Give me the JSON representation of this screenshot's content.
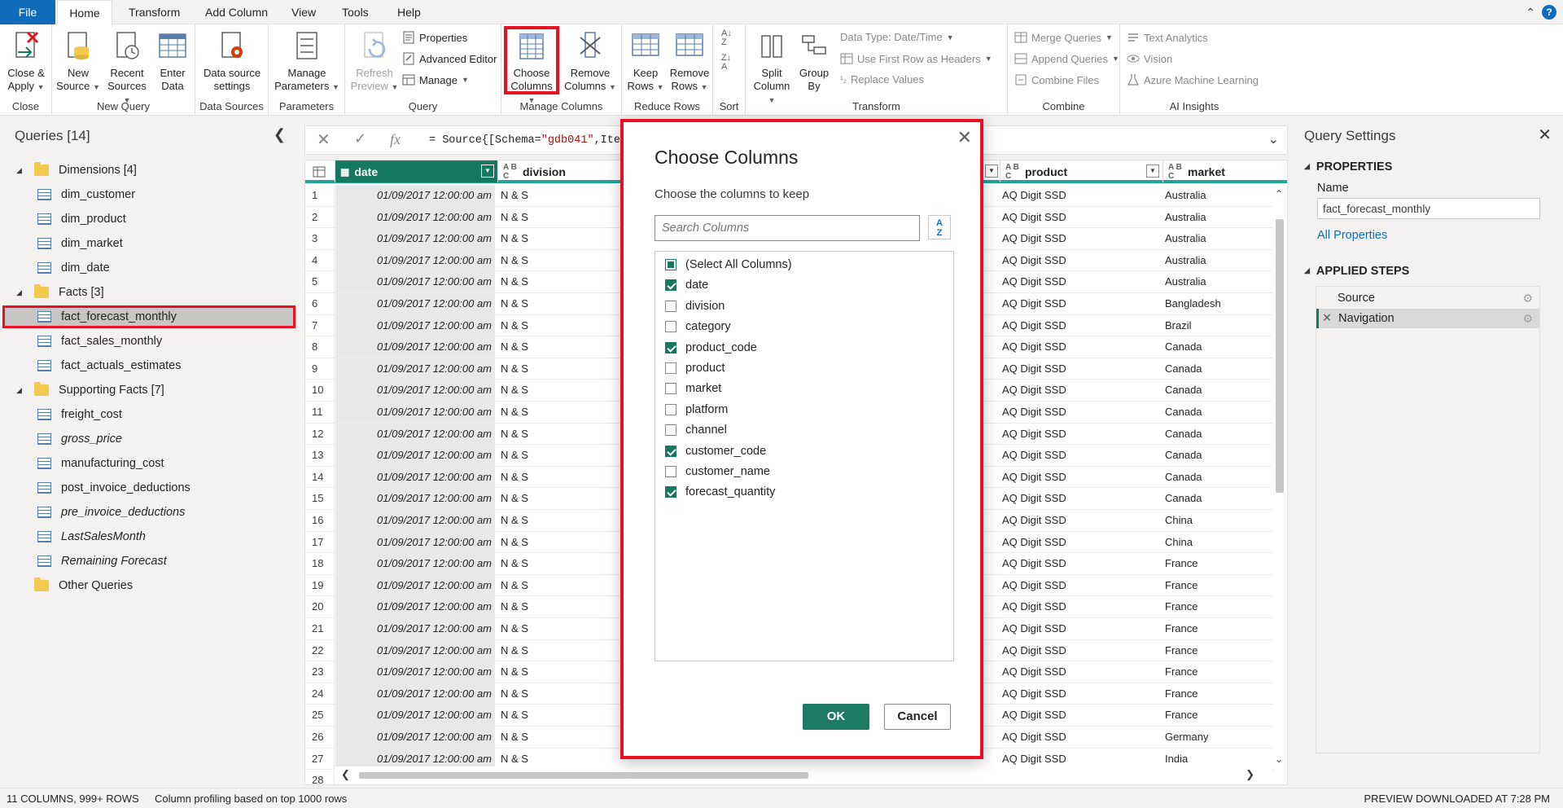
{
  "tabs": {
    "file": "File",
    "items": [
      "Home",
      "Transform",
      "Add Column",
      "View",
      "Tools",
      "Help"
    ],
    "active": "Home"
  },
  "ribbon": {
    "close": {
      "group": "Close",
      "close_apply": "Close &",
      "close_apply2": "Apply"
    },
    "new_query": {
      "group": "New Query",
      "new_source": [
        "New",
        "Source"
      ],
      "recent_sources": [
        "Recent",
        "Sources"
      ],
      "enter_data": [
        "Enter",
        "Data"
      ]
    },
    "data_sources": {
      "group": "Data Sources",
      "settings": [
        "Data source",
        "settings"
      ]
    },
    "parameters": {
      "group": "Parameters",
      "manage": [
        "Manage",
        "Parameters"
      ]
    },
    "query": {
      "group": "Query",
      "refresh": [
        "Refresh",
        "Preview"
      ],
      "properties": "Properties",
      "advanced_editor": "Advanced Editor",
      "manage": "Manage"
    },
    "manage_columns": {
      "group": "Manage Columns",
      "choose": [
        "Choose",
        "Columns"
      ],
      "remove": [
        "Remove",
        "Columns"
      ]
    },
    "reduce_rows": {
      "group": "Reduce Rows",
      "keep": [
        "Keep",
        "Rows"
      ],
      "remove": [
        "Remove",
        "Rows"
      ]
    },
    "sort": {
      "group": "Sort"
    },
    "transform": {
      "group": "Transform",
      "split": [
        "Split",
        "Column"
      ],
      "group_by": [
        "Group",
        "By"
      ],
      "data_type": "Data Type: Date/Time",
      "first_row": "Use First Row as Headers",
      "replace": "Replace Values"
    },
    "combine": {
      "group": "Combine",
      "merge": "Merge Queries",
      "append": "Append Queries",
      "files": "Combine Files"
    },
    "ai": {
      "group": "AI Insights",
      "text": "Text Analytics",
      "vision": "Vision",
      "azure": "Azure Machine Learning"
    }
  },
  "queries": {
    "title": "Queries [14]",
    "items": [
      {
        "label": "Dimensions [4]",
        "type": "folder"
      },
      {
        "label": "dim_customer",
        "type": "table"
      },
      {
        "label": "dim_product",
        "type": "table"
      },
      {
        "label": "dim_market",
        "type": "table"
      },
      {
        "label": "dim_date",
        "type": "table"
      },
      {
        "label": "Facts [3]",
        "type": "folder"
      },
      {
        "label": "fact_forecast_monthly",
        "type": "table",
        "selected": true
      },
      {
        "label": "fact_sales_monthly",
        "type": "table"
      },
      {
        "label": "fact_actuals_estimates",
        "type": "table"
      },
      {
        "label": "Supporting Facts [7]",
        "type": "folder"
      },
      {
        "label": "freight_cost",
        "type": "table"
      },
      {
        "label": "gross_price",
        "type": "table",
        "italic": true
      },
      {
        "label": "manufacturing_cost",
        "type": "table"
      },
      {
        "label": "post_invoice_deductions",
        "type": "table"
      },
      {
        "label": "pre_invoice_deductions",
        "type": "table",
        "italic": true
      },
      {
        "label": "LastSalesMonth",
        "type": "param",
        "italic": true
      },
      {
        "label": "Remaining Forecast",
        "type": "table",
        "italic": true
      },
      {
        "label": "Other Queries",
        "type": "folder-noarrow"
      }
    ]
  },
  "formula": {
    "prefix": "= Source{[Schema=",
    "schema": "\"gdb041\"",
    "suffix": ",Ite"
  },
  "grid": {
    "headers": {
      "date": "date",
      "division": "division",
      "product": "product",
      "market": "market",
      "abc": "A B C"
    },
    "date_value": "01/09/2017 12:00:00 am",
    "division_value": "N & S",
    "product_value": "AQ Digit SSD",
    "markets": [
      "Australia",
      "Australia",
      "Australia",
      "Australia",
      "Australia",
      "Bangladesh",
      "Brazil",
      "Canada",
      "Canada",
      "Canada",
      "Canada",
      "Canada",
      "Canada",
      "Canada",
      "Canada",
      "China",
      "China",
      "France",
      "France",
      "France",
      "France",
      "France",
      "France",
      "France",
      "France",
      "Germany",
      "India",
      ""
    ]
  },
  "settings": {
    "title": "Query Settings",
    "properties": "PROPERTIES",
    "name_label": "Name",
    "name_value": "fact_forecast_monthly",
    "all_properties": "All Properties",
    "applied_steps": "APPLIED STEPS",
    "steps": [
      "Source",
      "Navigation"
    ]
  },
  "status": {
    "left": "11 COLUMNS, 999+ ROWS",
    "profiling": "Column profiling based on top 1000 rows",
    "right": "PREVIEW DOWNLOADED AT 7:28 PM"
  },
  "dialog": {
    "title": "Choose Columns",
    "subtitle": "Choose the columns to keep",
    "search_placeholder": "Search Columns",
    "ok": "OK",
    "cancel": "Cancel",
    "columns": [
      {
        "label": "(Select All Columns)",
        "state": "partial"
      },
      {
        "label": "date",
        "state": "checked"
      },
      {
        "label": "division",
        "state": "unchecked"
      },
      {
        "label": "category",
        "state": "unchecked"
      },
      {
        "label": "product_code",
        "state": "checked"
      },
      {
        "label": "product",
        "state": "unchecked"
      },
      {
        "label": "market",
        "state": "unchecked"
      },
      {
        "label": "platform",
        "state": "unchecked"
      },
      {
        "label": "channel",
        "state": "unchecked"
      },
      {
        "label": "customer_code",
        "state": "checked"
      },
      {
        "label": "customer_name",
        "state": "unchecked"
      },
      {
        "label": "forecast_quantity",
        "state": "checked"
      }
    ]
  },
  "colors": {
    "accent": "#15785f",
    "highlight": "#e81123",
    "file_tab": "#0f6cbd"
  }
}
